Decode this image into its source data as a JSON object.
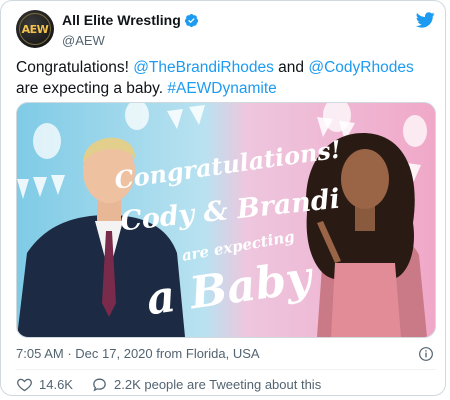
{
  "account": {
    "display_name": "All Elite Wrestling",
    "handle": "@AEW",
    "avatar_text": "AEW"
  },
  "tweet": {
    "parts": [
      {
        "type": "text",
        "value": "Congratulations! "
      },
      {
        "type": "mention",
        "value": "@TheBrandiRhodes"
      },
      {
        "type": "text",
        "value": " and "
      },
      {
        "type": "mention",
        "value": "@CodyRhodes"
      },
      {
        "type": "text",
        "value": " are expecting a baby. "
      },
      {
        "type": "hashtag",
        "value": "#AEWDynamite"
      }
    ]
  },
  "media": {
    "lines": [
      "Congratulations!",
      "Cody & Brandi",
      "are expecting",
      "a Baby"
    ]
  },
  "meta": {
    "time": "7:05 AM",
    "separator": "·",
    "date": "Dec 17, 2020",
    "location": "from Florida, USA"
  },
  "actions": {
    "like_count": "14.6K",
    "conversation_text": "2.2K people are Tweeting about this"
  },
  "colors": {
    "link": "#1d9bf0",
    "secondary_text": "#536471",
    "twitter_blue": "#1d9bf0"
  },
  "icons": {
    "verified": "verified-badge-icon",
    "brand": "twitter-bird-icon",
    "info": "info-icon",
    "like": "heart-icon",
    "reply": "speech-bubble-icon"
  }
}
